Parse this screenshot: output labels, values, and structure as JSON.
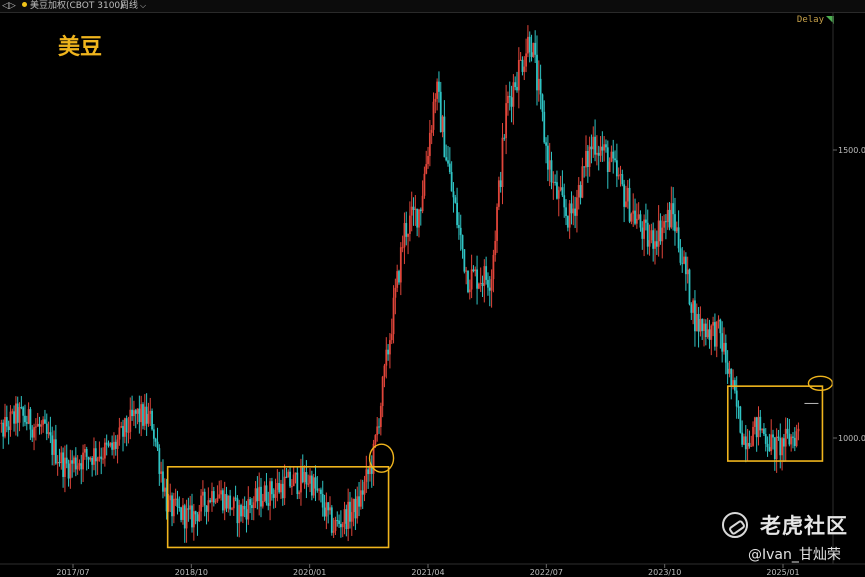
{
  "header": {
    "nav_glyph": "◁▷",
    "symbol": "美豆加权(CBOT 3100)",
    "period": "周线",
    "delay": "Delay"
  },
  "watermark": {
    "brand": "老虎社区",
    "user": "@Ivan_甘灿荣"
  },
  "colors": {
    "up": "#e0453a",
    "down": "#2fc4c4",
    "highlight": "#f0b51d",
    "label": "#f0b51d"
  },
  "chart_data": {
    "type": "candlestick",
    "title": "美豆",
    "x_tick_labels": [
      "2017/07",
      "2018/10",
      "2020/01",
      "2021/04",
      "2022/07",
      "2023/10",
      "2025/01"
    ],
    "y_tick_labels": [
      "1000.00",
      "1500.00"
    ],
    "y_range": [
      860,
      1790
    ],
    "path": [
      [
        "2016-09",
        1000
      ],
      [
        "2016-12",
        1040
      ],
      [
        "2017-03",
        1015
      ],
      [
        "2017-06",
        950
      ],
      [
        "2017-09",
        970
      ],
      [
        "2017-12",
        980
      ],
      [
        "2018-03",
        1040
      ],
      [
        "2018-05",
        1030
      ],
      [
        "2018-07",
        880
      ],
      [
        "2018-10",
        860
      ],
      [
        "2019-01",
        910
      ],
      [
        "2019-04",
        870
      ],
      [
        "2019-07",
        900
      ],
      [
        "2019-10",
        920
      ],
      [
        "2020-01",
        930
      ],
      [
        "2020-04",
        845
      ],
      [
        "2020-07",
        880
      ],
      [
        "2020-09",
        960
      ],
      [
        "2020-11",
        1160
      ],
      [
        "2021-01",
        1360
      ],
      [
        "2021-03",
        1400
      ],
      [
        "2021-05",
        1610
      ],
      [
        "2021-07",
        1430
      ],
      [
        "2021-09",
        1280
      ],
      [
        "2021-12",
        1280
      ],
      [
        "2022-02",
        1580
      ],
      [
        "2022-05",
        1700
      ],
      [
        "2022-07",
        1500
      ],
      [
        "2022-08",
        1430
      ],
      [
        "2022-10",
        1380
      ],
      [
        "2023-01",
        1520
      ],
      [
        "2023-03",
        1480
      ],
      [
        "2023-06",
        1390
      ],
      [
        "2023-08",
        1340
      ],
      [
        "2023-11",
        1390
      ],
      [
        "2024-02",
        1200
      ],
      [
        "2024-05",
        1180
      ],
      [
        "2024-08",
        1000
      ],
      [
        "2024-10",
        1020
      ],
      [
        "2024-12",
        980
      ],
      [
        "2025-03",
        1010
      ]
    ],
    "grid": false
  }
}
